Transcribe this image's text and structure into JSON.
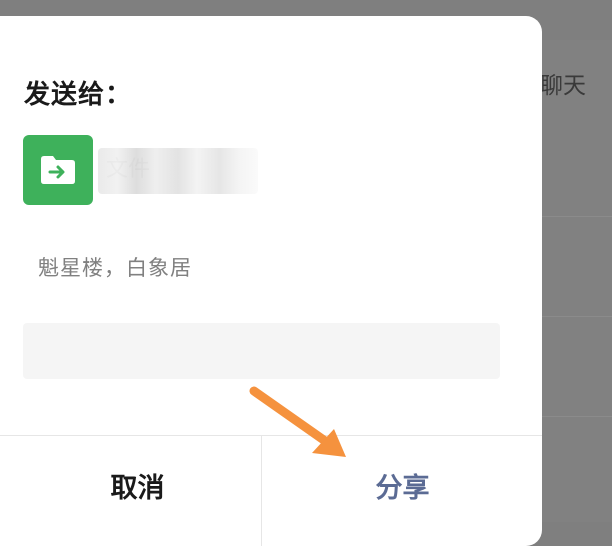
{
  "background": {
    "chat_label": "聊天"
  },
  "dialog": {
    "title": "发送给：",
    "recipient": {
      "name": "文件",
      "icon": "folder-share-icon",
      "icon_color": "#3eb15b"
    },
    "message_preview": "魁星楼，白象居",
    "input": {
      "placeholder": "",
      "value": ""
    },
    "buttons": {
      "cancel": "取消",
      "share": "分享"
    },
    "colors": {
      "share_text": "#5b6b94",
      "annotation_arrow": "#f5923e"
    }
  }
}
